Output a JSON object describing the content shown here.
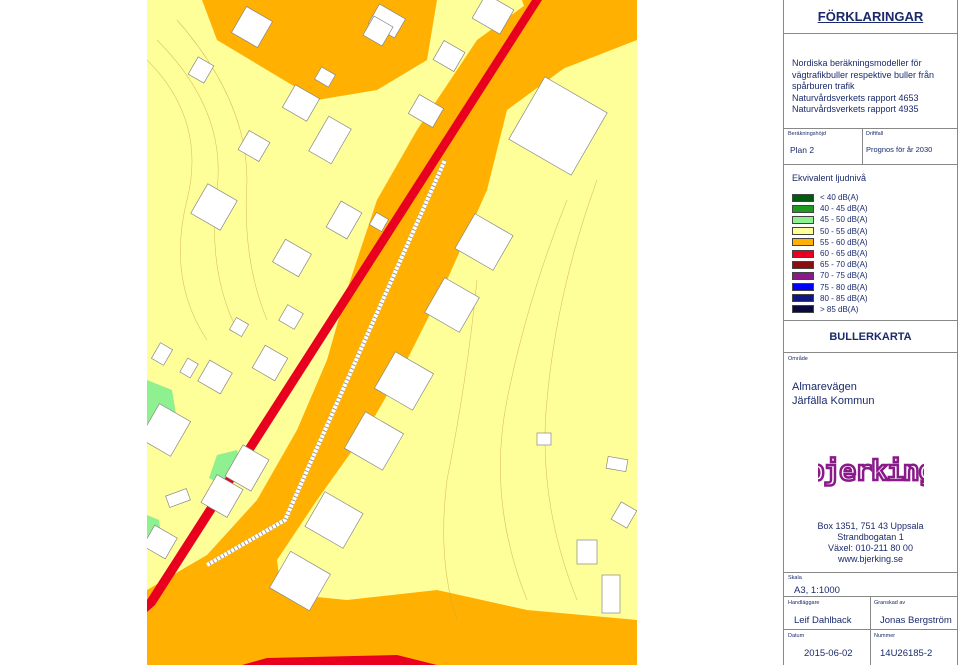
{
  "legend": {
    "title": "FÖRKLARINGAR",
    "methods": [
      "Nordiska beräkningsmodeller för",
      "vägtrafikbuller respektive buller från",
      "spårburen trafik",
      "Naturvårdsverkets rapport 4653",
      "Naturvårdsverkets rapport 4935"
    ],
    "calc_height_label": "Beräkningshöjd",
    "calc_height_value": "Plan 2",
    "operation_label": "Driftfall",
    "operation_value": "Prognos för år 2030",
    "scale_title": "Ekvivalent ljudnivå",
    "scale": [
      {
        "label": "< 40 dB(A)",
        "color": "#005a10"
      },
      {
        "label": "40 - 45 dB(A)",
        "color": "#1e9a1e"
      },
      {
        "label": "45 - 50 dB(A)",
        "color": "#8ef08e"
      },
      {
        "label": "50 - 55 dB(A)",
        "color": "#ffff9a"
      },
      {
        "label": "55 - 60 dB(A)",
        "color": "#ffb000"
      },
      {
        "label": "60 - 65 dB(A)",
        "color": "#e8001e"
      },
      {
        "label": "65 - 70 dB(A)",
        "color": "#8a1010"
      },
      {
        "label": "70 - 75 dB(A)",
        "color": "#8a1a8a"
      },
      {
        "label": "75 - 80 dB(A)",
        "color": "#0000ff"
      },
      {
        "label": "80 - 85 dB(A)",
        "color": "#101880"
      },
      {
        "label": "> 85 dB(A)",
        "color": "#0a0a40"
      }
    ],
    "map_type": "BULLERKARTA",
    "area_label": "Område",
    "area_line1": "Almarevägen",
    "area_line2": "Järfälla Kommun",
    "logo_text": "bjerking",
    "logo_color": "#8a1a8a",
    "address": [
      "Box 1351, 751 43 Uppsala",
      "Strandbogatan 1",
      "Växel: 010-211 80 00",
      "www.bjerking.se"
    ],
    "scale_label": "Skala",
    "scale_value": "A3, 1:1000",
    "handler_label": "Handläggare",
    "handler_value": "Leif Dahlback",
    "reviewer_label": "Granskad av",
    "reviewer_value": "Jonas Bergström",
    "date_label": "Datum",
    "date_value": "2015-06-02",
    "number_label": "Nummer",
    "number_value": "14U26185-2"
  }
}
